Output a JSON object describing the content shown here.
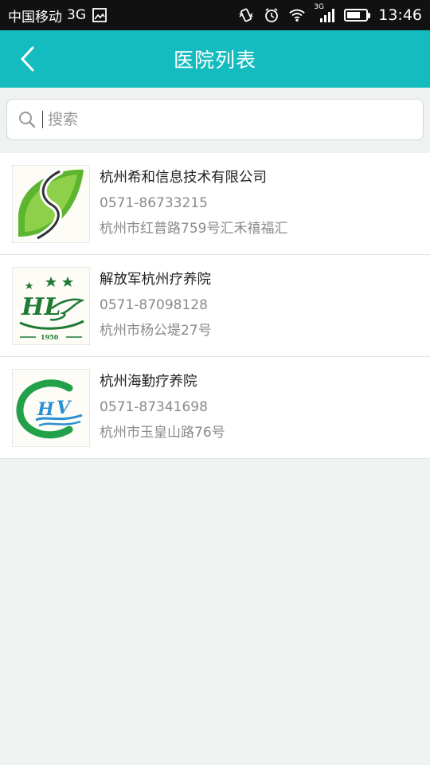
{
  "status_bar": {
    "carrier": "中国移动",
    "network": "3G",
    "signal_tag": "3G",
    "time": "13:46",
    "battery_level": 0.7,
    "icons": [
      "image-icon",
      "vibrate-icon",
      "alarm-icon",
      "wifi-icon",
      "signal-icon",
      "battery-icon"
    ]
  },
  "nav": {
    "title": "医院列表",
    "back_icon": "chevron-left-icon"
  },
  "search": {
    "placeholder": "搜索",
    "value": "",
    "icon": "search-icon"
  },
  "hospitals": [
    {
      "name": "杭州希和信息技术有限公司",
      "phone": "0571-86733215",
      "address": "杭州市红普路759号汇禾禧福汇",
      "logo": "green-leaf-s-logo"
    },
    {
      "name": "解放军杭州疗养院",
      "phone": "0571-87098128",
      "address": "杭州市杨公堤27号",
      "logo": "hl-dove-1950-logo"
    },
    {
      "name": "杭州海勤疗养院",
      "phone": "0571-87341698",
      "address": "杭州市玉皇山路76号",
      "logo": "hq-wave-logo"
    }
  ],
  "colors": {
    "accent": "#14bcc0",
    "background": "#eef3f1",
    "logo_green": "#1f8a3a",
    "logo_blue": "#2a8fd0"
  }
}
